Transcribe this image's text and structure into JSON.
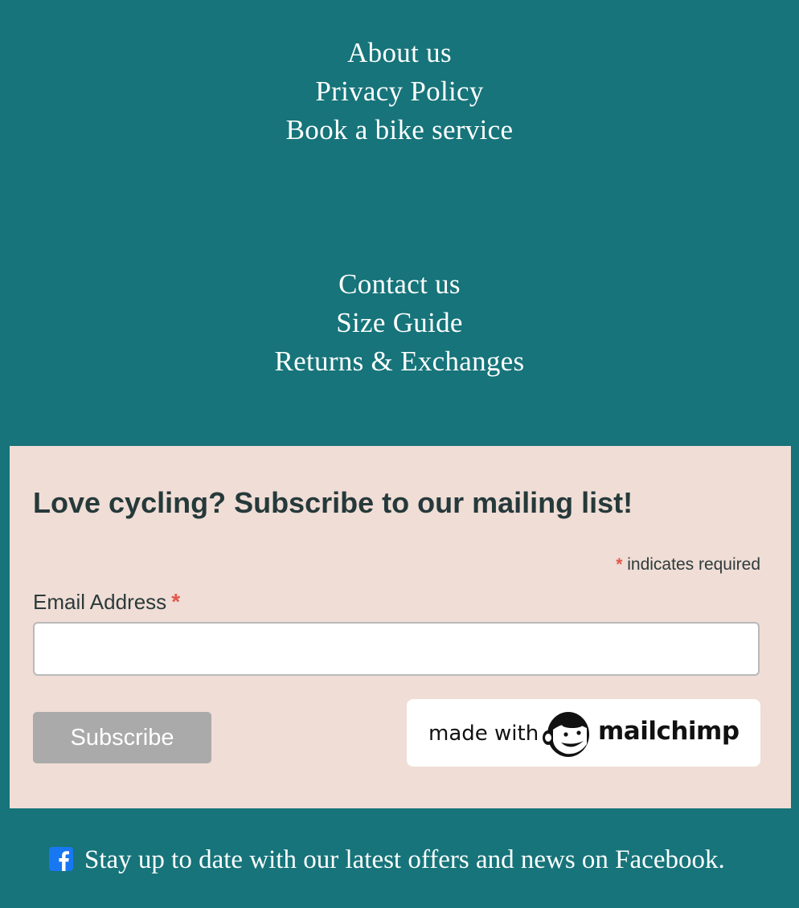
{
  "footer": {
    "links_group_1": [
      {
        "label": "About us"
      },
      {
        "label": "Privacy Policy"
      },
      {
        "label": "Book a bike service"
      }
    ],
    "links_group_2": [
      {
        "label": "Contact us"
      },
      {
        "label": "Size Guide"
      },
      {
        "label": "Returns & Exchanges"
      }
    ]
  },
  "signup": {
    "heading": "Love cycling? Subscribe to our mailing list!",
    "required_asterisk": "*",
    "required_note": "indicates required",
    "email_label": "Email Address",
    "email_asterisk": "*",
    "email_value": "",
    "subscribe_label": "Subscribe",
    "badge": {
      "made_with": "made with",
      "brand": "mailchimp",
      "icon": "mailchimp-freddie-icon"
    }
  },
  "social": {
    "icon": "facebook-icon",
    "text": "Stay up to date with our latest offers and news on Facebook."
  },
  "colors": {
    "background": "#16747a",
    "signup_background": "#efddd6",
    "required_asterisk": "#e2574c",
    "subscribe_button": "#aaaaaa",
    "facebook_blue": "#1877f2"
  }
}
